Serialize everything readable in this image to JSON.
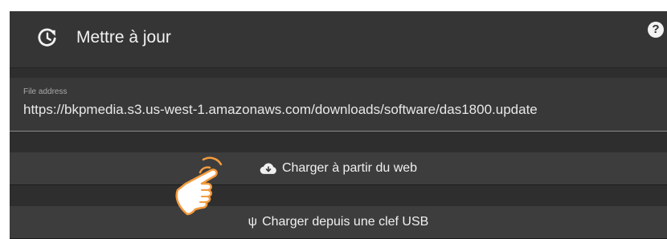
{
  "header": {
    "title": "Mettre à jour",
    "refresh_icon": "refresh-icon",
    "help_icon": "help-icon",
    "help_glyph": "?"
  },
  "file_field": {
    "label": "File address",
    "value": "https://bkpmedia.s3.us-west-1.amazonaws.com/downloads/software/das1800.update"
  },
  "buttons": {
    "web_label": "Charger à partir du web",
    "web_icon": "cloud-download-icon",
    "usb_label": "Charger depuis une clef USB",
    "usb_icon": "usb-icon",
    "usb_glyph": "ψ"
  },
  "overlay": {
    "pointer_icon": "tap-hand-icon"
  },
  "colors": {
    "panel": "#2e2e2e",
    "header": "#353535",
    "button": "#3d3d3d",
    "text": "#f0f0f0",
    "accent": "#f39a3d"
  }
}
